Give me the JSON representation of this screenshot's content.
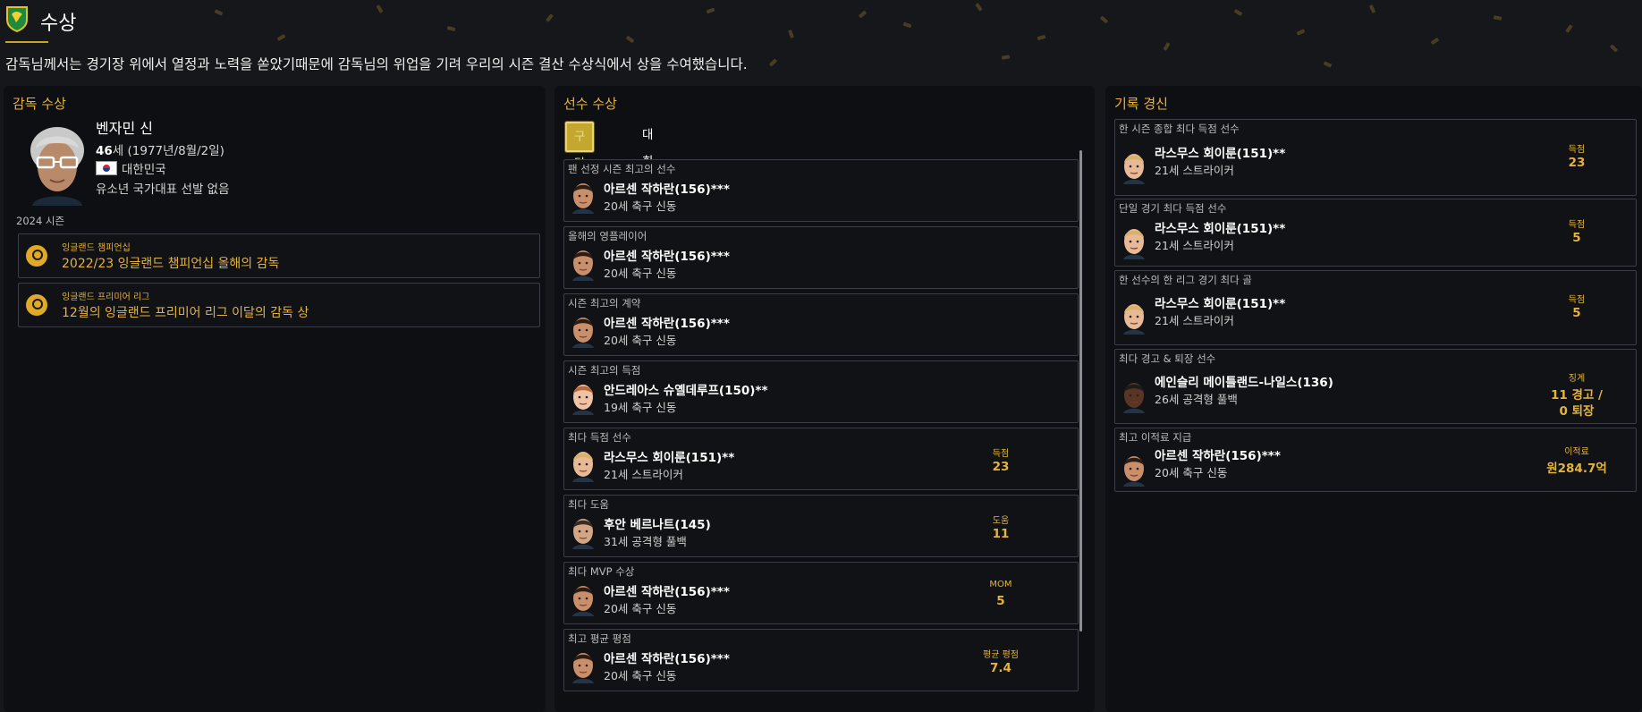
{
  "header": {
    "title": "수상",
    "message": "감독님께서는 경기장 위에서 열정과 노력을 쏟았기때문에 감독님의 위업을 기려 우리의 시즌 결산 수상식에서 상을 수여했습니다."
  },
  "manager_panel": {
    "title": "감독 수상",
    "name": "벤자민 신",
    "age_prefix": "46",
    "age_rest": "세 (1977년/8월/2일)",
    "nation": "대한민국",
    "youth_caps": "유소년 국가대표 선발 없음",
    "season": "2024 시즌",
    "awards": [
      {
        "competition": "잉글랜드 챔피언십",
        "name": "2022/23 잉글랜드 챔피언십 올해의 감독"
      },
      {
        "competition": "잉글랜드 프리미어 리그",
        "name": "12월의 잉글랜드 프리미어 리그 이달의 감독 상"
      }
    ]
  },
  "player_panel": {
    "title": "선수 수상",
    "tabs": [
      "구단 수상",
      "대회 수상"
    ],
    "awards": [
      {
        "category": "팬 선정 시즌 최고의 선수",
        "player": "아르센 작하란(156)***",
        "info": "20세 축구 신동",
        "stat_label": "",
        "stat_value": ""
      },
      {
        "category": "올해의 영플레이어",
        "player": "아르센 작하란(156)***",
        "info": "20세 축구 신동",
        "stat_label": "",
        "stat_value": ""
      },
      {
        "category": "시즌 최고의 계약",
        "player": "아르센 작하란(156)***",
        "info": "20세 축구 신동",
        "stat_label": "",
        "stat_value": ""
      },
      {
        "category": "시즌 최고의 득점",
        "player": "안드레아스 슈옐데루프(150)**",
        "info": "19세 축구 신동",
        "stat_label": "",
        "stat_value": ""
      },
      {
        "category": "최다 득점 선수",
        "player": "라스무스 회이룬(151)**",
        "info": "21세 스트라이커",
        "stat_label": "득점",
        "stat_value": "23"
      },
      {
        "category": "최다 도움",
        "player": "후안 베르나트(145)",
        "info": "31세 공격형 풀백",
        "stat_label": "도움",
        "stat_value": "11"
      },
      {
        "category": "최다 MVP 수상",
        "player": "아르센 작하란(156)***",
        "info": "20세 축구 신동",
        "stat_label": "MOM",
        "stat_value": "5"
      },
      {
        "category": "최고 평균 평점",
        "player": "아르센 작하란(156)***",
        "info": "20세 축구 신동",
        "stat_label": "평균 평점",
        "stat_value": "7.4"
      }
    ]
  },
  "records_panel": {
    "title": "기록 경신",
    "records": [
      {
        "category": "한 시즌 종합 최다 득점 선수",
        "player": "라스무스 회이룬(151)**",
        "info": "21세 스트라이커",
        "stat_label": "득점",
        "stat_value": "23"
      },
      {
        "category": "단일 경기 최다 득점 선수",
        "player": "라스무스 회이룬(151)**",
        "info": "21세 스트라이커",
        "stat_label": "득점",
        "stat_value": "5"
      },
      {
        "category": "한 선수의 한 리그 경기 최다 골",
        "player": "라스무스 회이룬(151)**",
        "info": "21세 스트라이커",
        "stat_label": "득점",
        "stat_value": "5"
      },
      {
        "category": "최다 경고 & 퇴장 선수",
        "player": "에인슬리 메이틀랜드-나일스(136)",
        "info": "26세 공격형 풀백",
        "stat_label": "징계",
        "stat_value": "11 경고 /",
        "stat_value2": "0 퇴장"
      },
      {
        "category": "최고 이적료 지급",
        "player": "아르센 작하란(156)***",
        "info": "20세 축구 신동",
        "stat_label": "이적료",
        "stat_value": "원284.7억"
      }
    ]
  },
  "colors": {
    "background": "#15171b",
    "panel": "#0e0f12",
    "accent": "#e6b33a",
    "border": "#3b3e45"
  },
  "icons": [
    "club-crest-icon",
    "award-medal-icon",
    "korea-flag-icon",
    "player-face-icon"
  ]
}
